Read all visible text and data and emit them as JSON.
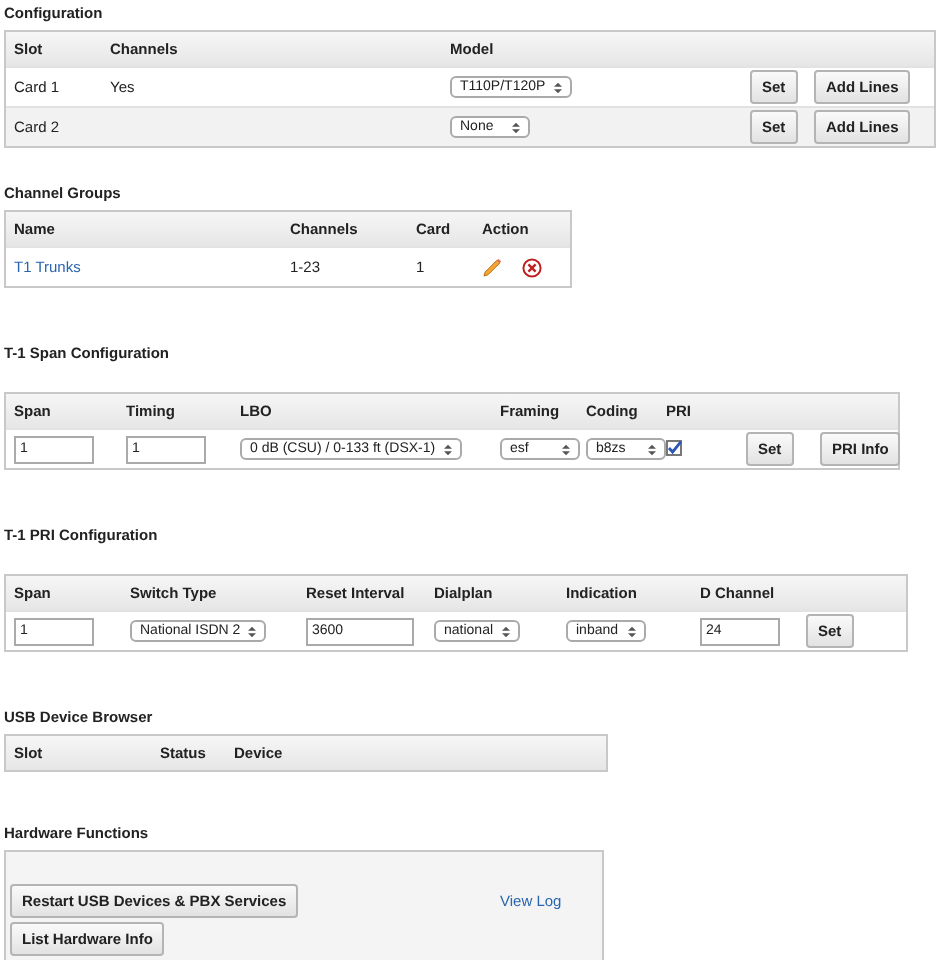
{
  "sections": [
    {
      "title": "Configuration",
      "kind": "table",
      "columns": [
        "Slot",
        "Channels",
        "Model"
      ],
      "rows": [
        {
          "cells": [
            {
              "kind": "text",
              "text": "Card 1"
            },
            {
              "kind": "text",
              "text": "Yes"
            },
            {
              "kind": "select",
              "value": "T110P/T120P"
            },
            {
              "kind": "button",
              "label": "Set"
            },
            {
              "kind": "button",
              "label": "Add Lines"
            }
          ]
        },
        {
          "cells": [
            {
              "kind": "text",
              "text": "Card 2"
            },
            {
              "kind": "blank"
            },
            {
              "kind": "select",
              "value": "None"
            },
            {
              "kind": "button",
              "label": "Set"
            },
            {
              "kind": "button",
              "label": "Add Lines"
            }
          ]
        }
      ]
    },
    {
      "title": "Channel Groups",
      "kind": "table",
      "columns": [
        "Name",
        "Channels",
        "Card",
        "Action"
      ],
      "rows": [
        {
          "cells": [
            {
              "kind": "link",
              "text": "T1 Trunks"
            },
            {
              "kind": "text",
              "text": "1-23"
            },
            {
              "kind": "text",
              "text": "1"
            },
            {
              "kind": "actions"
            }
          ]
        }
      ]
    },
    {
      "title": "T-1 Span Configuration",
      "kind": "table",
      "columns": [
        "Span",
        "Timing",
        "LBO",
        "Framing",
        "Coding",
        "PRI"
      ],
      "rows": [
        {
          "cells": [
            {
              "kind": "input",
              "value": "1"
            },
            {
              "kind": "input",
              "value": "1"
            },
            {
              "kind": "select",
              "value": "0 dB (CSU) / 0-133 ft (DSX-1)"
            },
            {
              "kind": "select",
              "value": "esf"
            },
            {
              "kind": "select",
              "value": "b8zs"
            },
            {
              "kind": "checkbox",
              "checked": true
            },
            {
              "kind": "button",
              "label": "Set"
            },
            {
              "kind": "button",
              "label": "PRI Info"
            }
          ]
        }
      ]
    },
    {
      "title": "T-1 PRI Configuration",
      "kind": "table",
      "columns": [
        "Span",
        "Switch Type",
        "Reset Interval",
        "Dialplan",
        "Indication",
        "D Channel"
      ],
      "rows": [
        {
          "cells": [
            {
              "kind": "input",
              "value": "1"
            },
            {
              "kind": "select",
              "value": "National ISDN 2"
            },
            {
              "kind": "input",
              "value": "3600"
            },
            {
              "kind": "select",
              "value": "national"
            },
            {
              "kind": "select",
              "value": "inband"
            },
            {
              "kind": "input",
              "value": "24"
            },
            {
              "kind": "button",
              "label": "Set"
            }
          ]
        }
      ]
    },
    {
      "title": "USB Device Browser",
      "kind": "table",
      "columns": [
        "Slot",
        "Status",
        "Device"
      ]
    },
    {
      "title": "Hardware Functions",
      "kind": "functions",
      "buttons": [
        "Restart USB Devices & PBX Services",
        "List Hardware Info"
      ],
      "link": "View Log"
    }
  ]
}
